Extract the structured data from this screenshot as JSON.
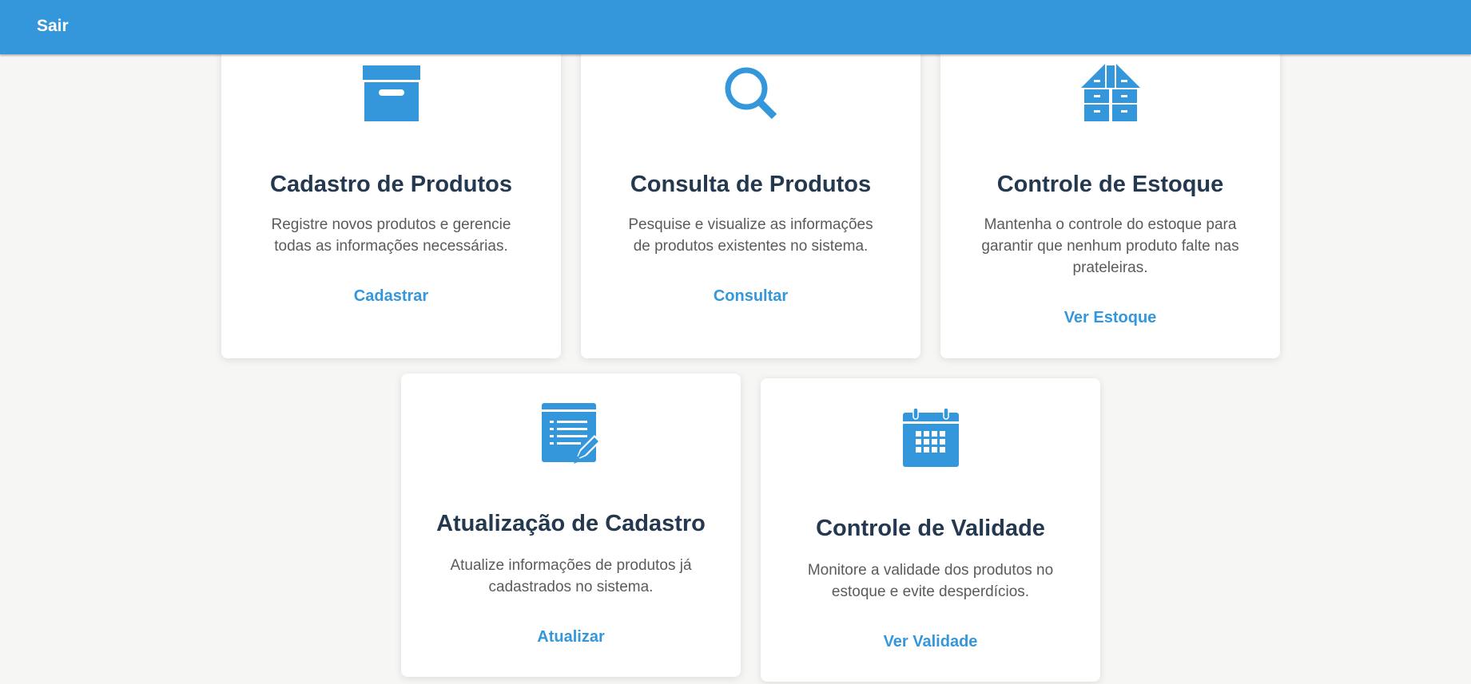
{
  "header": {
    "logout_label": "Sair",
    "background_color": "#3497db"
  },
  "accent_color": "#3497db",
  "cards": [
    {
      "icon": "archive-box-icon",
      "title": "Cadastro de Produtos",
      "description": "Registre novos produtos e gerencie todas as informações necessárias.",
      "link_label": "Cadastrar"
    },
    {
      "icon": "magnifier-icon",
      "title": "Consulta de Produtos",
      "description": "Pesquise e visualize as informações de produtos existentes no sistema.",
      "link_label": "Consultar"
    },
    {
      "icon": "warehouse-icon",
      "title": "Controle de Estoque",
      "description": "Mantenha o controle do estoque para garantir que nenhum produto falte nas prateleiras.",
      "link_label": "Ver Estoque"
    },
    {
      "icon": "document-edit-icon",
      "title": "Atualização de Cadastro",
      "description": "Atualize informações de produtos já cadastrados no sistema.",
      "link_label": "Atualizar"
    },
    {
      "icon": "calendar-icon",
      "title": "Controle de Validade",
      "description": "Monitore a validade dos produtos no estoque e evite desperdícios.",
      "link_label": "Ver Validade"
    }
  ]
}
